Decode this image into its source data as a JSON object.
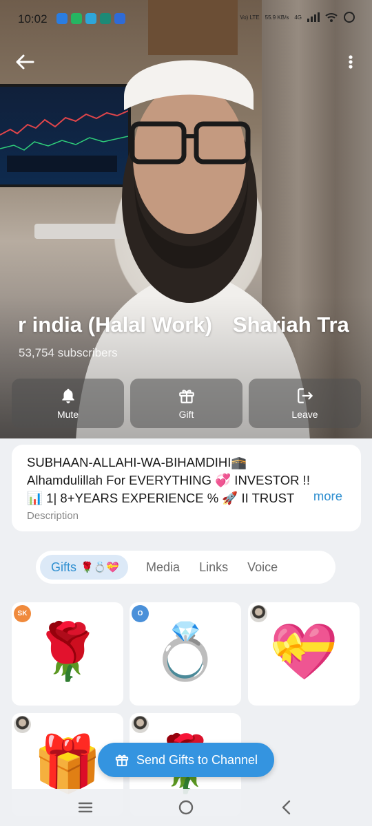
{
  "status": {
    "time": "10:02",
    "net": "Vo) LTE",
    "speed": "55.9 KB/s",
    "signal": "4G"
  },
  "channel": {
    "title_part1": "r india (Halal Work)",
    "title_part2": "Shariah Tra",
    "subscribers": "53,754 subscribers"
  },
  "actions": {
    "mute": "Mute",
    "gift": "Gift",
    "leave": "Leave"
  },
  "description": {
    "line1": "SUBHAAN-ALLAHI-WA-BIHAMDIHI🕋",
    "line2": "Alhamdulillah For EVERYTHING 💞 INVESTOR !!",
    "line3": "📊 1| 8+YEARS EXPERIENCE % 🚀 II TRUST",
    "more": "more",
    "label": "Description"
  },
  "tabs": {
    "gifts": "Gifts",
    "gifts_emoji": "🌹💍💝",
    "media": "Media",
    "links": "Links",
    "voice": "Voice"
  },
  "gifts": {
    "badge_sk": "SK",
    "badge_o": "O",
    "rose": "🌹",
    "ring": "💍",
    "heart": "💝",
    "box": "🎁",
    "sprout": "🌹"
  },
  "send_button": "Send Gifts to Channel",
  "colors": {
    "accent": "#3494e0",
    "link": "#2f8fd0",
    "badge_sk": "#f08a3c",
    "badge_o": "#4a90d9"
  }
}
